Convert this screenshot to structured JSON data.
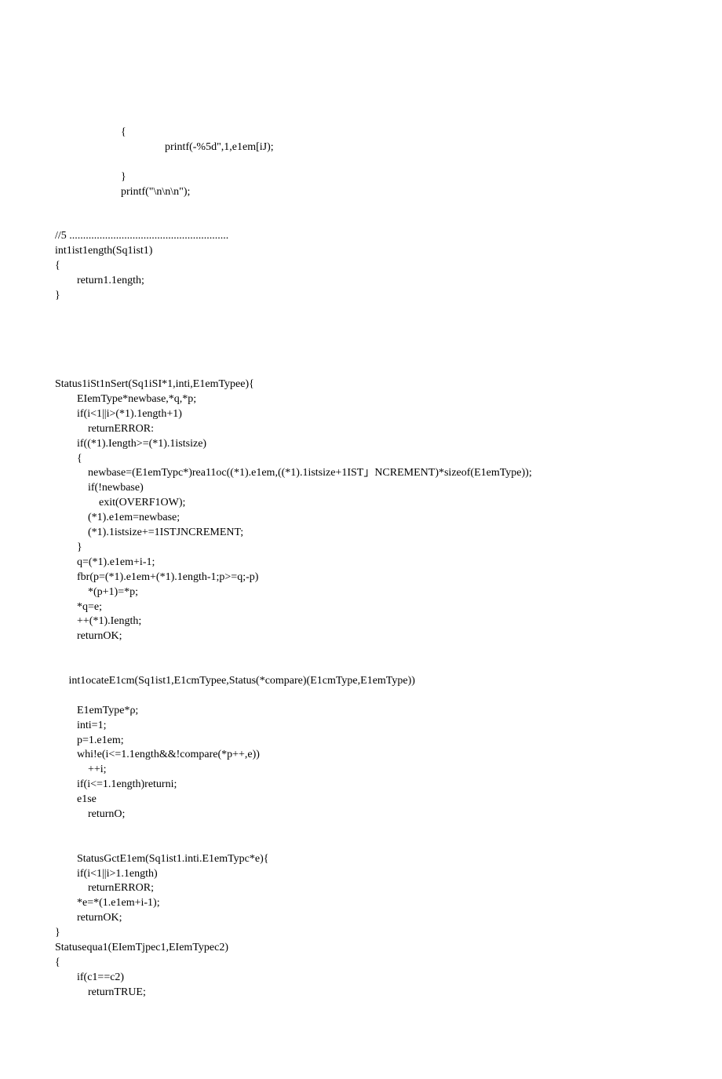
{
  "code_lines": [
    "                        {",
    "                                        printf(-%5d\",1,e1em[iJ);",
    "",
    "                        }",
    "                        printf(\"\\n\\n\\n\");",
    "",
    "",
    "//5 ..........................................................",
    "int1ist1ength(Sq1ist1)",
    "{",
    "        return1.1ength;",
    "}",
    "",
    "",
    "",
    "",
    "",
    "Status1iSt1nSert(Sq1iSI*1,inti,E1emTypee){",
    "        EIemType*newbase,*q,*p;",
    "        if(i<1||i>(*1).1ength+1)",
    "            returnERROR:",
    "        if((*1).Iength>=(*1).1istsize)",
    "        {",
    "            newbase=(E1emTypc*)rea11oc((*1).e1em,((*1).1istsize+1IST」NCREMENT)*sizeof(E1emType));",
    "            if(!newbase)",
    "                exit(OVERF1OW);",
    "            (*1).e1em=newbase;",
    "            (*1).1istsize+=1ISTJNCREMENT;",
    "        }",
    "        q=(*1).e1em+i-1;",
    "        fbr(p=(*1).e1em+(*1).1ength-1;p>=q;-p)",
    "            *(p+1)=*p;",
    "        *q=e;",
    "        ++(*1).Iength;",
    "        returnOK;",
    "",
    "",
    "     int1ocateE1cm(Sq1ist1,E1cmTypee,Status(*compare)(E1cmType,E1emType))",
    "",
    "        E1emType*ρ;",
    "        inti=1;",
    "        p=1.e1em;",
    "        whi!e(i<=1.1ength&&!compare(*p++,e))",
    "            ++i;",
    "        if(i<=1.1ength)returni;",
    "        e1se",
    "            returnO;",
    "",
    "",
    "        StatusGctE1em(Sq1ist1.inti.E1emTypc*e){",
    "        if(i<1||i>1.1ength)",
    "            returnERROR;",
    "        *e=*(1.e1em+i-1);",
    "        returnOK;",
    "}",
    "Statusequa1(EIemTjpec1,EIemTypec2)",
    "{",
    "        if(c1==c2)",
    "            returnTRUE;"
  ]
}
